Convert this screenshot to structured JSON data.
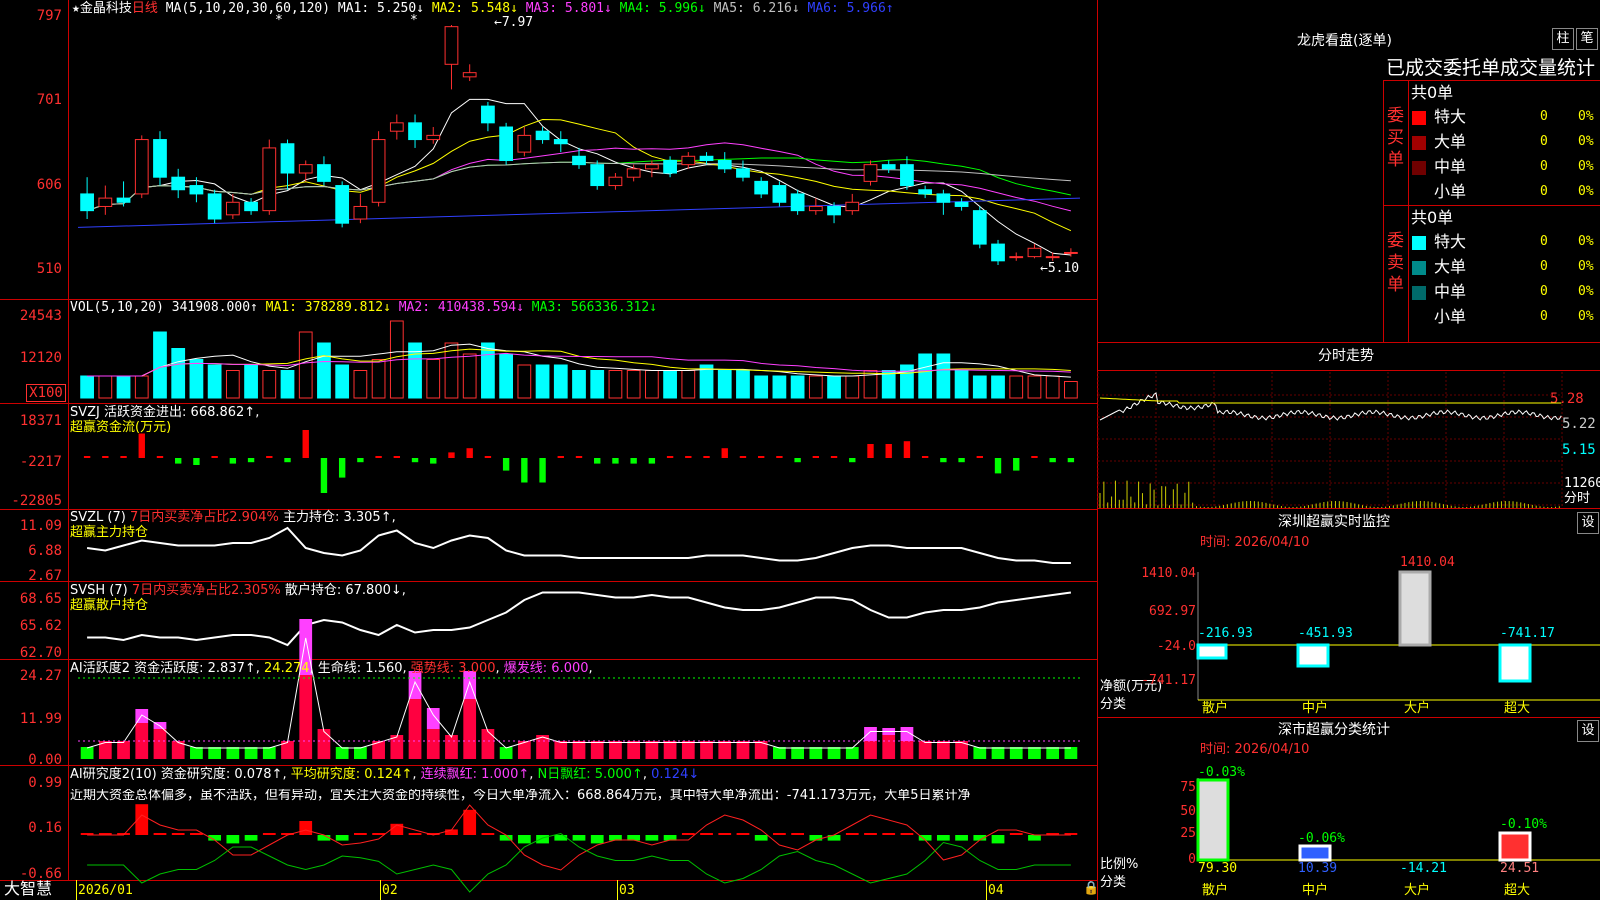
{
  "main_chart": {
    "stock_star": "★",
    "stock_name": "金晶科技",
    "period": "日线",
    "ma_params": "MA(5,10,20,30,60,120)",
    "ma1": "MA1: 5.250↓",
    "ma2": "MA2: 5.548↓",
    "ma3": "MA3: 5.801↓",
    "ma4": "MA4: 5.996↓",
    "ma5": "MA5: 6.216↓",
    "ma6": "MA6: 5.966↑",
    "high_label": "7.97",
    "low_label": "5.10",
    "y_ticks": [
      "797",
      "701",
      "606",
      "510"
    ],
    "star_markers": [
      "*",
      "*"
    ]
  },
  "vol_panel": {
    "params": "VOL(5,10,20)",
    "value": "341908.000↑",
    "ma1": "MA1: 378289.812↓",
    "ma2": "MA2: 410438.594↓",
    "ma3": "MA3: 566336.312↓",
    "y_ticks": [
      "24543",
      "12120"
    ],
    "unit": "X100"
  },
  "svzj_panel": {
    "name": "SVZJ",
    "text1": "活跃资金进出: 668.862↑,",
    "text2": "超赢资金流(万元)",
    "y_ticks": [
      "18371",
      "-2217",
      "-22805"
    ]
  },
  "svzl_panel": {
    "name": "SVZL (7)",
    "ratio": "7日内买卖净占比2.904%",
    "hold": "主力持仓: 3.305↑,",
    "sub": "超赢主力持仓",
    "y_ticks": [
      "11.09",
      "6.88",
      "2.67"
    ]
  },
  "svsh_panel": {
    "name": "SVSH (7)",
    "ratio": "7日内买卖净占比2.305%",
    "hold": "散户持仓: 67.800↓,",
    "sub": "超赢散户持仓",
    "y_ticks": [
      "68.65",
      "65.62",
      "62.70"
    ]
  },
  "ai_active_panel": {
    "name": "AI活跃度2",
    "active": "资金活跃度: 2.837↑",
    "v2": "24.274",
    "life": "生命线: 1.560",
    "strong": "强势线: 3.000",
    "burst": "爆发线: 6.000",
    "y_ticks": [
      "24.27",
      "11.99",
      "0.00"
    ]
  },
  "ai_research_panel": {
    "name": "AI研究度2(10)",
    "research": "资金研究度: 0.078↑",
    "avg": "平均研究度: 0.124↑",
    "red": "连续飘红: 1.000↑",
    "nred": "N日飘红: 5.000↑",
    "last": "0.124↓",
    "comment": "近期大资金总体偏多，虽不活跃，但有异动，宜关注大资金的持续性，今日大单净流入：668.864万元，其中特大单净流出：-741.173万元，大单5日累计净",
    "y_ticks": [
      "0.99",
      "0.16",
      "-0.66"
    ]
  },
  "bottom_bar": {
    "brand": "大智慧",
    "months": [
      "2026/01",
      "02",
      "03",
      "04"
    ]
  },
  "right": {
    "longhu_title": "龙虎看盘(逐单)",
    "btn_zhu": "柱",
    "btn_bi": "笔",
    "stats_title": "已成交委托单成交量统计",
    "buy": {
      "label": "委买单",
      "total": "共0单",
      "rows": [
        {
          "name": "特大",
          "val": "0",
          "pct": "0%",
          "color": "#ff0000"
        },
        {
          "name": "大单",
          "val": "0",
          "pct": "0%",
          "color": "#a00000"
        },
        {
          "name": "中单",
          "val": "0",
          "pct": "0%",
          "color": "#700000"
        },
        {
          "name": "小单",
          "val": "0",
          "pct": "0%",
          "color": "#000000"
        }
      ]
    },
    "sell": {
      "label": "委卖单",
      "total": "共0单",
      "rows": [
        {
          "name": "特大",
          "val": "0",
          "pct": "0%",
          "color": "#00ffff"
        },
        {
          "name": "大单",
          "val": "0",
          "pct": "0%",
          "color": "#008b8b"
        },
        {
          "name": "中单",
          "val": "0",
          "pct": "0%",
          "color": "#006a6a"
        },
        {
          "name": "小单",
          "val": "0",
          "pct": "0%",
          "color": "#000000"
        }
      ]
    },
    "intraday": {
      "title": "分时走势",
      "y_ticks": [
        "5.28",
        "5.22",
        "5.15"
      ],
      "vol": "11260",
      "vol2": "分时"
    },
    "monitor": {
      "title": "深圳超赢实时监控",
      "btn": "设",
      "time": "时间: 2026/04/10",
      "y_ticks": [
        "1410.04",
        "692.97",
        "-24.0",
        "-741.17"
      ],
      "unit1": "净额(万元)",
      "unit2": "分类",
      "bars": [
        {
          "cat": "散户",
          "val": "-216.93"
        },
        {
          "cat": "中户",
          "val": "-451.93"
        },
        {
          "cat": "大户",
          "val": "1410.04"
        },
        {
          "cat": "超大",
          "val": "-741.17"
        }
      ]
    },
    "classify": {
      "title": "深市超赢分类统计",
      "btn": "设",
      "time": "时间: 2026/04/10",
      "y_ticks": [
        "75",
        "50",
        "25",
        "0"
      ],
      "unit1": "比例%",
      "unit2": "分类",
      "bars": [
        {
          "cat": "散户",
          "top": "-0.03%",
          "val": "79.30"
        },
        {
          "cat": "中户",
          "top": "-0.06%",
          "val": "10.39"
        },
        {
          "cat": "大户",
          "top": "",
          "val": "-14.21"
        },
        {
          "cat": "超大",
          "top": "-0.10%",
          "val": "24.51"
        }
      ]
    }
  },
  "chart_data": {
    "type": "candlestick",
    "ylim": [
      5.1,
      7.97
    ],
    "candles": [
      [
        5.95,
        5.75,
        6.15,
        5.65
      ],
      [
        5.8,
        5.9,
        6.05,
        5.7
      ],
      [
        5.9,
        5.85,
        6.1,
        5.8
      ],
      [
        5.95,
        6.6,
        6.65,
        5.9
      ],
      [
        6.6,
        6.15,
        6.7,
        6.05
      ],
      [
        6.15,
        6.0,
        6.25,
        5.9
      ],
      [
        6.05,
        5.95,
        6.15,
        5.85
      ],
      [
        5.95,
        5.65,
        6.0,
        5.6
      ],
      [
        5.7,
        5.85,
        5.95,
        5.65
      ],
      [
        5.85,
        5.75,
        5.9,
        5.7
      ],
      [
        5.75,
        6.5,
        6.6,
        5.7
      ],
      [
        6.55,
        6.2,
        6.6,
        6.0
      ],
      [
        6.2,
        6.3,
        6.35,
        6.1
      ],
      [
        6.3,
        6.1,
        6.4,
        6.05
      ],
      [
        6.05,
        5.6,
        6.1,
        5.55
      ],
      [
        5.65,
        5.8,
        5.95,
        5.6
      ],
      [
        5.85,
        6.6,
        6.7,
        5.8
      ],
      [
        6.7,
        6.8,
        6.9,
        6.6
      ],
      [
        6.8,
        6.6,
        6.9,
        6.5
      ],
      [
        6.6,
        6.65,
        6.75,
        6.55
      ],
      [
        7.5,
        7.95,
        7.97,
        7.2
      ],
      [
        7.35,
        7.4,
        7.5,
        7.3
      ],
      [
        7.0,
        6.8,
        7.05,
        6.7
      ],
      [
        6.75,
        6.35,
        6.8,
        6.3
      ],
      [
        6.45,
        6.65,
        6.75,
        6.4
      ],
      [
        6.7,
        6.6,
        6.75,
        6.55
      ],
      [
        6.6,
        6.55,
        6.7,
        6.45
      ],
      [
        6.4,
        6.3,
        6.5,
        6.25
      ],
      [
        6.3,
        6.05,
        6.35,
        6.0
      ],
      [
        6.05,
        6.15,
        6.2,
        6.0
      ],
      [
        6.15,
        6.25,
        6.3,
        6.1
      ],
      [
        6.25,
        6.3,
        6.35,
        6.15
      ],
      [
        6.35,
        6.2,
        6.4,
        6.15
      ],
      [
        6.3,
        6.4,
        6.45,
        6.25
      ],
      [
        6.4,
        6.35,
        6.45,
        6.3
      ],
      [
        6.35,
        6.25,
        6.45,
        6.2
      ],
      [
        6.25,
        6.15,
        6.35,
        6.1
      ],
      [
        6.1,
        5.95,
        6.15,
        5.9
      ],
      [
        6.05,
        5.85,
        6.1,
        5.8
      ],
      [
        5.95,
        5.75,
        6.0,
        5.7
      ],
      [
        5.75,
        5.8,
        5.9,
        5.7
      ],
      [
        5.8,
        5.7,
        5.85,
        5.6
      ],
      [
        5.75,
        5.85,
        5.95,
        5.7
      ],
      [
        6.1,
        6.3,
        6.35,
        6.05
      ],
      [
        6.3,
        6.25,
        6.35,
        6.2
      ],
      [
        6.3,
        6.05,
        6.4,
        6.0
      ],
      [
        6.0,
        5.95,
        6.05,
        5.9
      ],
      [
        5.95,
        5.85,
        6.0,
        5.7
      ],
      [
        5.85,
        5.8,
        5.9,
        5.75
      ],
      [
        5.75,
        5.35,
        5.8,
        5.3
      ],
      [
        5.35,
        5.15,
        5.4,
        5.1
      ],
      [
        5.2,
        5.2,
        5.25,
        5.15
      ],
      [
        5.2,
        5.3,
        5.35,
        5.18
      ],
      [
        5.2,
        5.2,
        5.25,
        5.15
      ],
      [
        5.25,
        5.25,
        5.3,
        5.2
      ]
    ]
  }
}
